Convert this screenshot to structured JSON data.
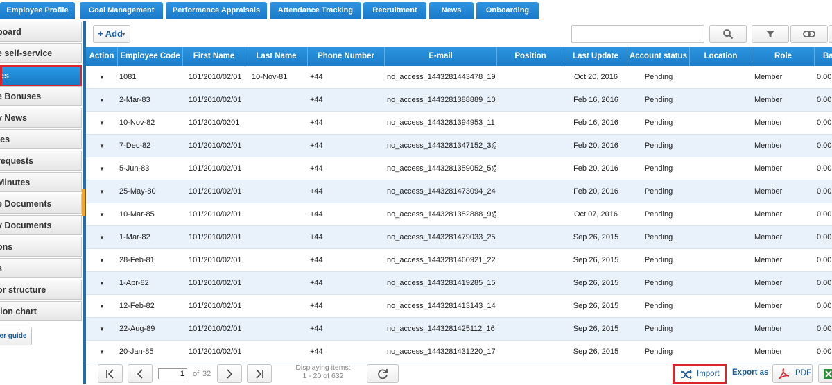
{
  "top_tabs": [
    "Employee Profile",
    "Goal Management",
    "Performance Appraisals",
    "Attendance Tracking",
    "Recruitment",
    "News",
    "Onboarding"
  ],
  "sidebar": {
    "items": [
      "board",
      "e self-service",
      "es",
      "e Bonuses",
      "y News",
      "tes",
      "requests",
      "Minutes",
      "e Documents",
      "y Documents",
      "ons",
      "s",
      "or structure",
      "tion chart"
    ],
    "active_index": 2,
    "guide_label": "ser guide"
  },
  "toolbar": {
    "add_label": "+ Add",
    "search_placeholder": "",
    "icons": [
      "search-icon",
      "filter-icon",
      "link-icon"
    ]
  },
  "grid": {
    "columns": [
      "Action",
      "Employee Code",
      "First Name",
      "Last Name",
      "Phone Number",
      "E-mail",
      "Position",
      "Last Update",
      "Account status",
      "Location",
      "Role",
      "Ba"
    ],
    "rows": [
      {
        "code": "1081",
        "first": "101/2010/02/01",
        "last": "10-Nov-81",
        "phone": "+44",
        "email": "no_access_1443281443478_19",
        "position": "",
        "updated": "Oct 20, 2016",
        "status": "Pending",
        "location": "",
        "role": "Member",
        "ba": "0.00"
      },
      {
        "code": "2-Mar-83",
        "first": "101/2010/02/01",
        "last": "",
        "phone": "+44",
        "email": "no_access_1443281388889_10",
        "position": "",
        "updated": "Feb 16, 2016",
        "status": "Pending",
        "location": "",
        "role": "Member",
        "ba": "0.00"
      },
      {
        "code": "10-Nov-82",
        "first": "101/2010/0201",
        "last": "",
        "phone": "+44",
        "email": "no_access_1443281394953_11",
        "position": "",
        "updated": "Feb 16, 2016",
        "status": "Pending",
        "location": "",
        "role": "Member",
        "ba": "0.00"
      },
      {
        "code": "7-Dec-82",
        "first": "101/2010/02/01",
        "last": "",
        "phone": "+44",
        "email": "no_access_1443281347152_3@",
        "position": "",
        "updated": "Feb 20, 2016",
        "status": "Pending",
        "location": "",
        "role": "Member",
        "ba": "0.00"
      },
      {
        "code": "5-Jun-83",
        "first": "101/2010/02/01",
        "last": "",
        "phone": "+44",
        "email": "no_access_1443281359052_5@",
        "position": "",
        "updated": "Feb 20, 2016",
        "status": "Pending",
        "location": "",
        "role": "Member",
        "ba": "0.00"
      },
      {
        "code": "25-May-80",
        "first": "101/2010/02/01",
        "last": "",
        "phone": "+44",
        "email": "no_access_1443281473094_24",
        "position": "",
        "updated": "Feb 20, 2016",
        "status": "Pending",
        "location": "",
        "role": "Member",
        "ba": "0.00"
      },
      {
        "code": "10-Mar-85",
        "first": "101/2010/02/01",
        "last": "",
        "phone": "+44",
        "email": "no_access_1443281382888_9@",
        "position": "",
        "updated": "Oct 07, 2016",
        "status": "Pending",
        "location": "",
        "role": "Member",
        "ba": "0.00"
      },
      {
        "code": "1-Mar-82",
        "first": "101/2010/02/01",
        "last": "",
        "phone": "+44",
        "email": "no_access_1443281479033_25",
        "position": "",
        "updated": "Sep 26, 2015",
        "status": "Pending",
        "location": "",
        "role": "Member",
        "ba": "0.00"
      },
      {
        "code": "28-Feb-81",
        "first": "101/2010/02/01",
        "last": "",
        "phone": "+44",
        "email": "no_access_1443281460921_22",
        "position": "",
        "updated": "Sep 26, 2015",
        "status": "Pending",
        "location": "",
        "role": "Member",
        "ba": "0.00"
      },
      {
        "code": "1-Apr-82",
        "first": "101/2010/02/01",
        "last": "",
        "phone": "+44",
        "email": "no_access_1443281419285_15",
        "position": "",
        "updated": "Sep 26, 2015",
        "status": "Pending",
        "location": "",
        "role": "Member",
        "ba": "0.00"
      },
      {
        "code": "12-Feb-82",
        "first": "101/2010/02/01",
        "last": "",
        "phone": "+44",
        "email": "no_access_1443281413143_14",
        "position": "",
        "updated": "Sep 26, 2015",
        "status": "Pending",
        "location": "",
        "role": "Member",
        "ba": "0.00"
      },
      {
        "code": "22-Aug-89",
        "first": "101/2010/02/01",
        "last": "",
        "phone": "+44",
        "email": "no_access_1443281425112_16",
        "position": "",
        "updated": "Sep 26, 2015",
        "status": "Pending",
        "location": "",
        "role": "Member",
        "ba": "0.00"
      },
      {
        "code": "20-Jan-85",
        "first": "101/2010/02/01",
        "last": "",
        "phone": "+44",
        "email": "no_access_1443281431220_17",
        "position": "",
        "updated": "Sep 26, 2015",
        "status": "Pending",
        "location": "",
        "role": "Member",
        "ba": "0.00"
      }
    ]
  },
  "pager": {
    "page": "1",
    "of_label": "of",
    "total_pages": "32",
    "display_label": "Displaying items:",
    "display_range": "1 - 20 of 632",
    "import_label": "Import",
    "export_label": "Export as",
    "pdf_label": "PDF"
  },
  "colors": {
    "accent": "#1b7cc8",
    "highlight": "#d9262e",
    "row_alt": "#e9f2fb"
  }
}
